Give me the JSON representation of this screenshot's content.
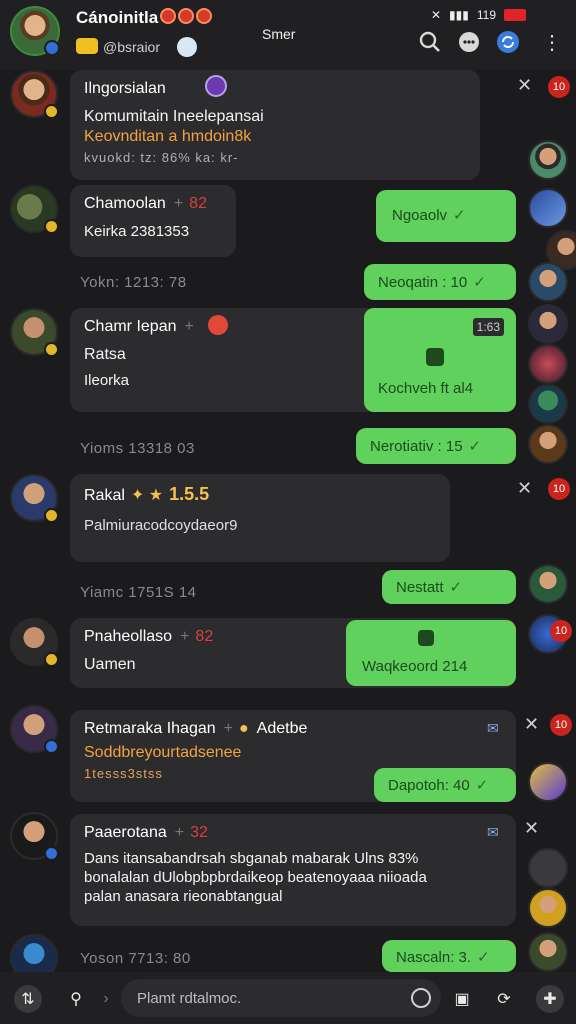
{
  "header": {
    "title": "Cánoinitla",
    "subtitle": "@bsraior",
    "center_label": "Smer",
    "time": "119"
  },
  "messages": [
    {
      "name": "Ilngorsialan",
      "lines": [
        "Komumitain Ineelepansai",
        "Keovnditan a hmdoin8k",
        "kvuokd: tz: 86% ka: kr-"
      ]
    },
    {
      "name": "Chamoolan",
      "badge": "82",
      "lines": [
        "Keirka 2381353"
      ],
      "ts": "Yokn: 1213: 78",
      "out": [
        "Ngoaolv",
        "Neoqatin : 10"
      ]
    },
    {
      "name": "Chamr Iepan",
      "lines": [
        "Ratsa",
        "Ileorka"
      ],
      "ts": "Yioms 13318 03",
      "out": [
        "Kochveh ft al4",
        "Nerotiativ : 15"
      ],
      "card_code": "1:63"
    },
    {
      "name": "Rakal",
      "rating": "1.5.5",
      "lines": [
        "Palmiuracodcoydaeor9"
      ],
      "ts": "Yiamc 1751S 14",
      "out": [
        "Nestatt"
      ]
    },
    {
      "name": "Pnaheollaso",
      "badge": "82",
      "lines": [
        "Uamen"
      ],
      "out": [
        "Waqkeoord 214"
      ]
    },
    {
      "name": "Retmaraka Ihagan",
      "extra": "Adetbe",
      "lines": [
        "Soddbreyourtadsenee",
        "1tesss3stss"
      ],
      "out": [
        "Dapotoh: 40"
      ]
    },
    {
      "name": "Paaerotana",
      "badge": "32",
      "lines": [
        "Dans itansabandrsah sbganab mabarak Ulns 83%",
        "bonalalan dUlobpbpbrdaikeop beatenoyaaa niioada",
        "palan anasara rieonabtangual"
      ],
      "ts": "Yoson 7713: 80",
      "out": [
        "Nascaln: 3."
      ]
    }
  ],
  "composer": {
    "placeholder": "Plamt rdtalmoc."
  },
  "badges": {
    "b1": "10",
    "b2": "10",
    "b3": "10",
    "b4": "10"
  },
  "colors": {
    "bubble_out": "#5fd15c",
    "bubble_in": "#2c2c2f",
    "background": "#1b1b1d"
  }
}
